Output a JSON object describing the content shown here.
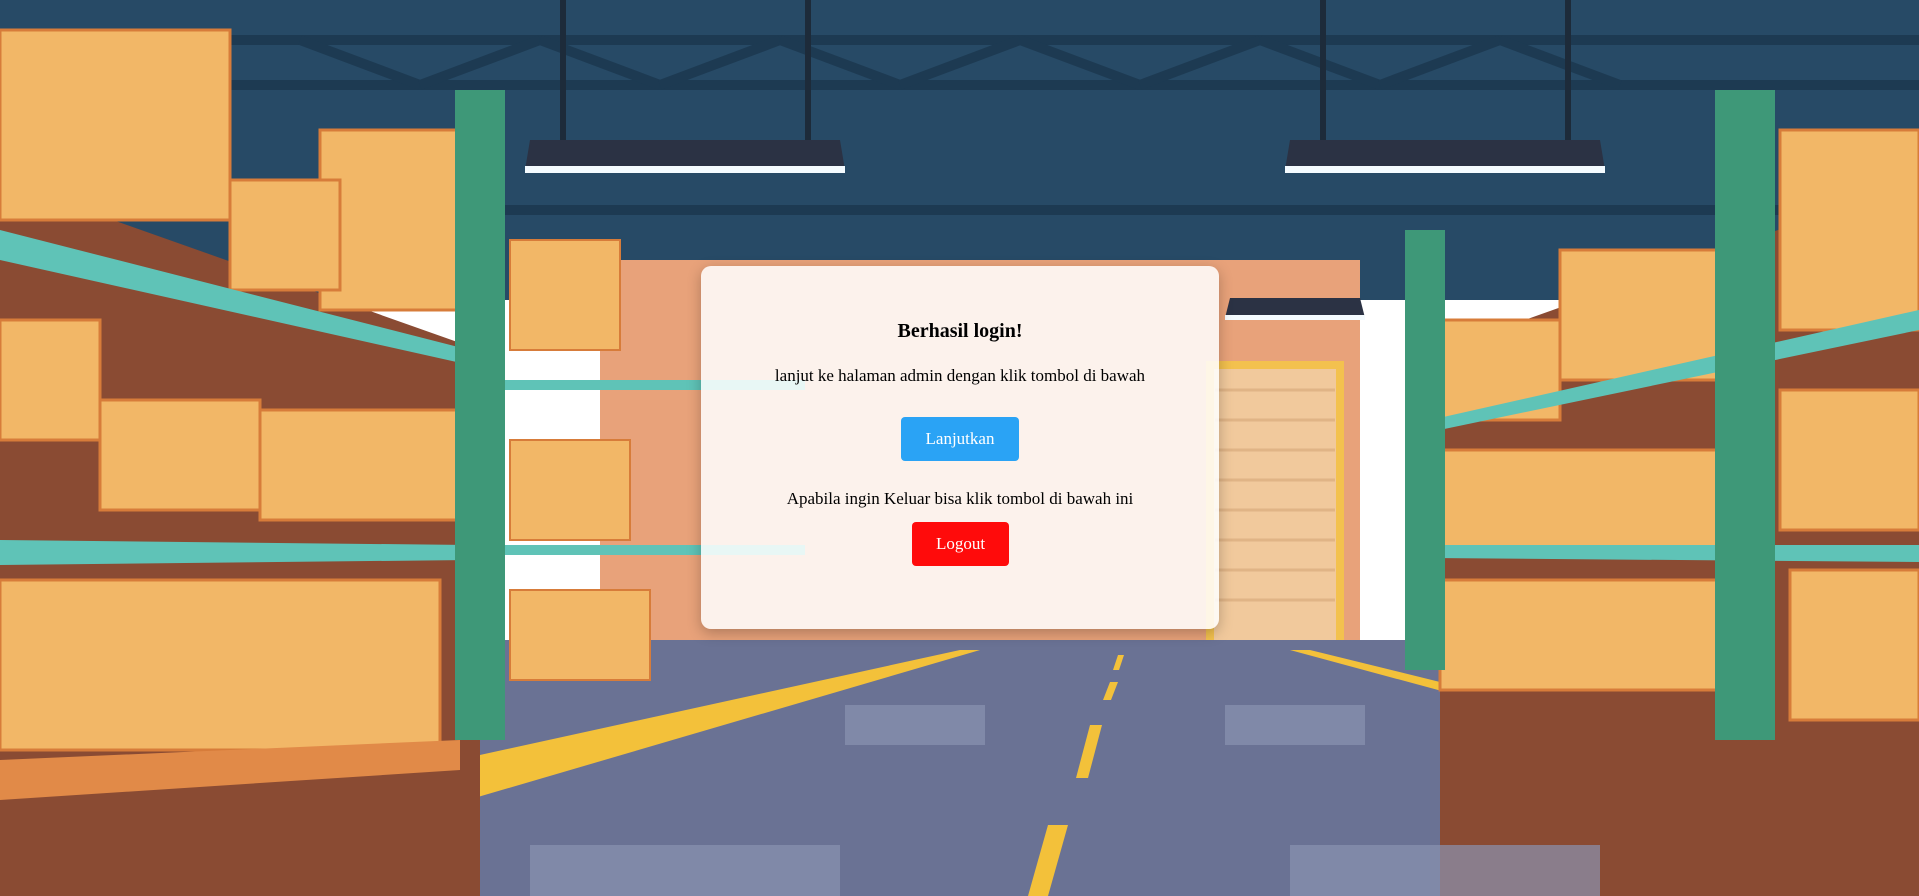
{
  "card": {
    "title": "Berhasil login!",
    "message": "lanjut ke halaman admin dengan klik tombol di bawah",
    "continue_label": "Lanjutkan",
    "logout_message": "Apabila ingin Keluar bisa klik tombol di bawah ini",
    "logout_label": "Logout"
  },
  "colors": {
    "primary_button": "#2aa3f5",
    "danger_button": "#ff0b0b"
  }
}
